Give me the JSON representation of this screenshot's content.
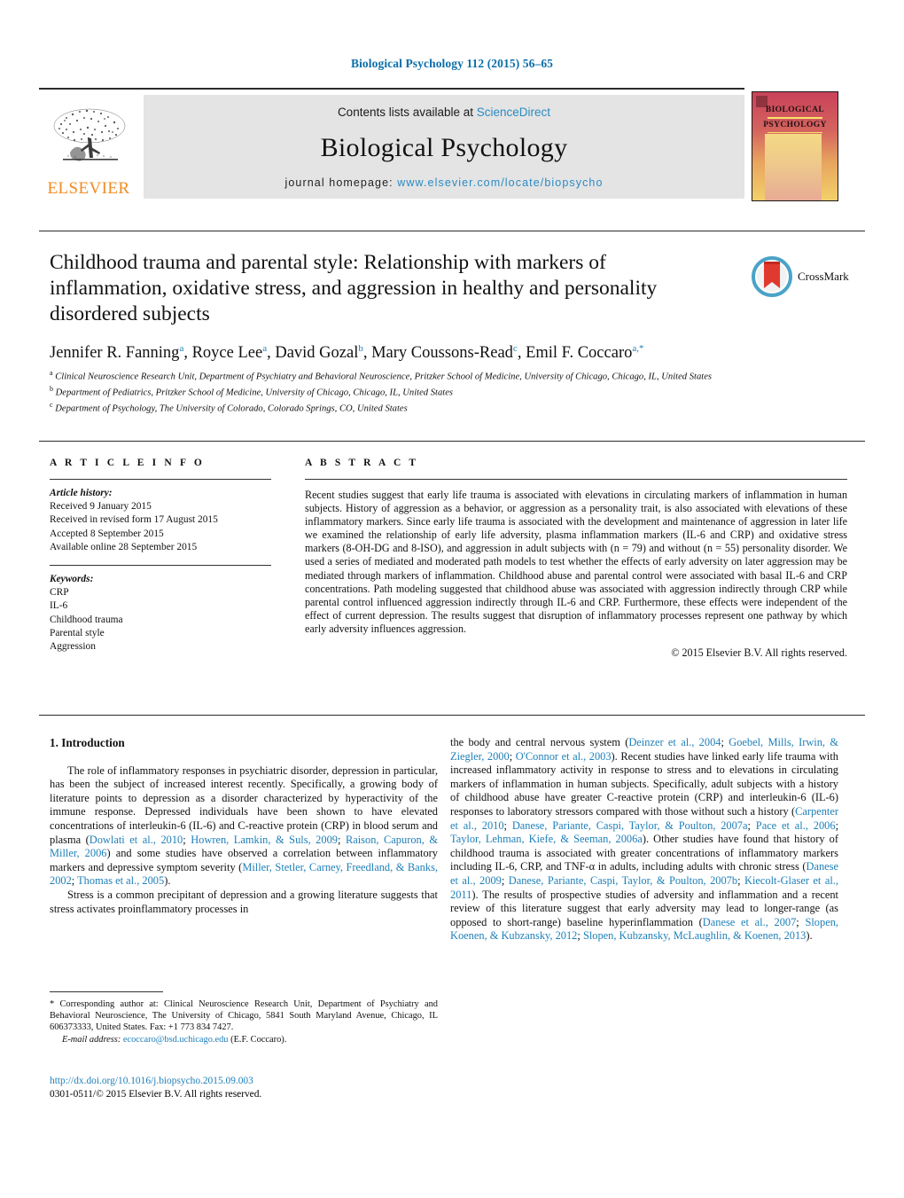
{
  "running_head": "Biological Psychology 112 (2015) 56–65",
  "masthead": {
    "contents_prefix": "Contents lists available at ",
    "contents_link": "ScienceDirect",
    "journal_name": "Biological Psychology",
    "homepage_prefix": "journal homepage: ",
    "homepage_url": "www.elsevier.com/locate/biopsycho",
    "publisher": "ELSEVIER"
  },
  "cover": {
    "line1": "BIOLOGICAL",
    "line2": "PSYCHOLOGY"
  },
  "article": {
    "title": "Childhood trauma and parental style: Relationship with markers of inflammation, oxidative stress, and aggression in healthy and personality disordered subjects",
    "crossmark_label": "CrossMark",
    "authors_html": "Jennifer R. Fanning<sup>a</sup>, Royce Lee<sup>a</sup>, David Gozal<sup>b</sup>, Mary Coussons-Read<sup>c</sup>, Emil F. Coccaro<sup>a,*</sup>",
    "affiliations": [
      "a Clinical Neuroscience Research Unit, Department of Psychiatry and Behavioral Neuroscience, Pritzker School of Medicine, University of Chicago, Chicago, IL, United States",
      "b Department of Pediatrics, Pritzker School of Medicine, University of Chicago, Chicago, IL, United States",
      "c Department of Psychology, The University of Colorado, Colorado Springs, CO, United States"
    ]
  },
  "article_info": {
    "heading": "A R T I C L E   I N F O",
    "history_label": "Article history:",
    "history": [
      "Received 9 January 2015",
      "Received in revised form 17 August 2015",
      "Accepted 8 September 2015",
      "Available online 28 September 2015"
    ],
    "keywords_label": "Keywords:",
    "keywords": [
      "CRP",
      "IL-6",
      "Childhood trauma",
      "Parental style",
      "Aggression"
    ]
  },
  "abstract": {
    "heading": "A B S T R A C T",
    "text": "Recent studies suggest that early life trauma is associated with elevations in circulating markers of inflammation in human subjects. History of aggression as a behavior, or aggression as a personality trait, is also associated with elevations of these inflammatory markers. Since early life trauma is associated with the development and maintenance of aggression in later life we examined the relationship of early life adversity, plasma inflammation markers (IL-6 and CRP) and oxidative stress markers (8-OH-DG and 8-ISO), and aggression in adult subjects with (n = 79) and without (n = 55) personality disorder. We used a series of mediated and moderated path models to test whether the effects of early adversity on later aggression may be mediated through markers of inflammation. Childhood abuse and parental control were associated with basal IL-6 and CRP concentrations. Path modeling suggested that childhood abuse was associated with aggression indirectly through CRP while parental control influenced aggression indirectly through IL-6 and CRP. Furthermore, these effects were independent of the effect of current depression. The results suggest that disruption of inflammatory processes represent one pathway by which early adversity influences aggression.",
    "copyright": "© 2015 Elsevier B.V. All rights reserved."
  },
  "body": {
    "section_number_title": "1.  Introduction",
    "left_paragraph_1_parts": [
      {
        "t": "The role of inflammatory responses in psychiatric disorder, depression in particular, has been the subject of increased interest recently. Specifically, a growing body of literature points to depression as a disorder characterized by hyperactivity of the immune response. Depressed individuals have been shown to have elevated concentrations of interleukin-6 (IL-6) and C-reactive protein (CRP) in blood serum and plasma (",
        "r": false
      },
      {
        "t": "Dowlati et al., 2010",
        "r": true
      },
      {
        "t": "; ",
        "r": false
      },
      {
        "t": "Howren, Lamkin, & Suls, 2009",
        "r": true
      },
      {
        "t": "; ",
        "r": false
      },
      {
        "t": "Raison, Capuron, & Miller, 2006",
        "r": true
      },
      {
        "t": ") and some studies have observed a correlation between inflammatory markers and depressive symptom severity (",
        "r": false
      },
      {
        "t": "Miller, Stetler, Carney, Freedland, & Banks, 2002",
        "r": true
      },
      {
        "t": "; ",
        "r": false
      },
      {
        "t": "Thomas et al., 2005",
        "r": true
      },
      {
        "t": ").",
        "r": false
      }
    ],
    "left_paragraph_2_parts": [
      {
        "t": "Stress is a common precipitant of depression and a growing literature suggests that stress activates proinflammatory processes in",
        "r": false
      }
    ],
    "right_paragraph_1_parts": [
      {
        "t": "the body and central nervous system (",
        "r": false
      },
      {
        "t": "Deinzer et al., 2004",
        "r": true
      },
      {
        "t": "; ",
        "r": false
      },
      {
        "t": "Goebel, Mills, Irwin, & Ziegler, 2000",
        "r": true
      },
      {
        "t": "; ",
        "r": false
      },
      {
        "t": "O'Connor et al., 2003",
        "r": true
      },
      {
        "t": "). Recent studies have linked early life trauma with increased inflammatory activity in response to stress and to elevations in circulating markers of inflammation in human subjects. Specifically, adult subjects with a history of childhood abuse have greater C-reactive protein (CRP) and interleukin-6 (IL-6) responses to laboratory stressors compared with those without such a history (",
        "r": false
      },
      {
        "t": "Carpenter et al., 2010",
        "r": true
      },
      {
        "t": "; ",
        "r": false
      },
      {
        "t": "Danese, Pariante, Caspi, Taylor, & Poulton, 2007a",
        "r": true
      },
      {
        "t": "; ",
        "r": false
      },
      {
        "t": "Pace et al., 2006",
        "r": true
      },
      {
        "t": "; ",
        "r": false
      },
      {
        "t": "Taylor, Lehman, Kiefe, & Seeman, 2006a",
        "r": true
      },
      {
        "t": "). Other studies have found that history of childhood trauma is associated with greater concentrations of inflammatory markers including IL-6, CRP, and TNF-α in adults, including adults with chronic stress (",
        "r": false
      },
      {
        "t": "Danese et al., 2009",
        "r": true
      },
      {
        "t": "; ",
        "r": false
      },
      {
        "t": "Danese, Pariante, Caspi, Taylor, & Poulton, 2007b",
        "r": true
      },
      {
        "t": "; ",
        "r": false
      },
      {
        "t": "Kiecolt-Glaser et al., 2011",
        "r": true
      },
      {
        "t": "). The results of prospective studies of adversity and inflammation and a recent review of this literature suggest that early adversity may lead to longer-range (as opposed to short-range) baseline hyperinflammation (",
        "r": false
      },
      {
        "t": "Danese et al., 2007",
        "r": true
      },
      {
        "t": "; ",
        "r": false
      },
      {
        "t": "Slopen, Koenen, & Kubzansky, 2012",
        "r": true
      },
      {
        "t": "; ",
        "r": false
      },
      {
        "t": "Slopen, Kubzansky, McLaughlin, & Koenen, 2013",
        "r": true
      },
      {
        "t": ").",
        "r": false
      }
    ]
  },
  "footnote": {
    "corresponding_marker": "*",
    "corresponding_text": " Corresponding author at: Clinical Neuroscience Research Unit, Department of Psychiatry and Behavioral Neuroscience, The University of Chicago, 5841 South Maryland Avenue, Chicago, IL 606373333, United States. Fax: +1 773 834 7427.",
    "email_label": "E-mail address:",
    "email": "ecoccaro@bsd.uchicago.edu",
    "email_suffix": " (E.F. Coccaro)."
  },
  "doi": {
    "url": "http://dx.doi.org/10.1016/j.biopsycho.2015.09.003",
    "issn_line": "0301-0511/© 2015 Elsevier B.V. All rights reserved."
  },
  "colors": {
    "link": "#1e7fb8",
    "running_head": "#0b6ea8",
    "elsevier_orange": "#F28B20",
    "masthead_bg": "#e4e4e4"
  }
}
